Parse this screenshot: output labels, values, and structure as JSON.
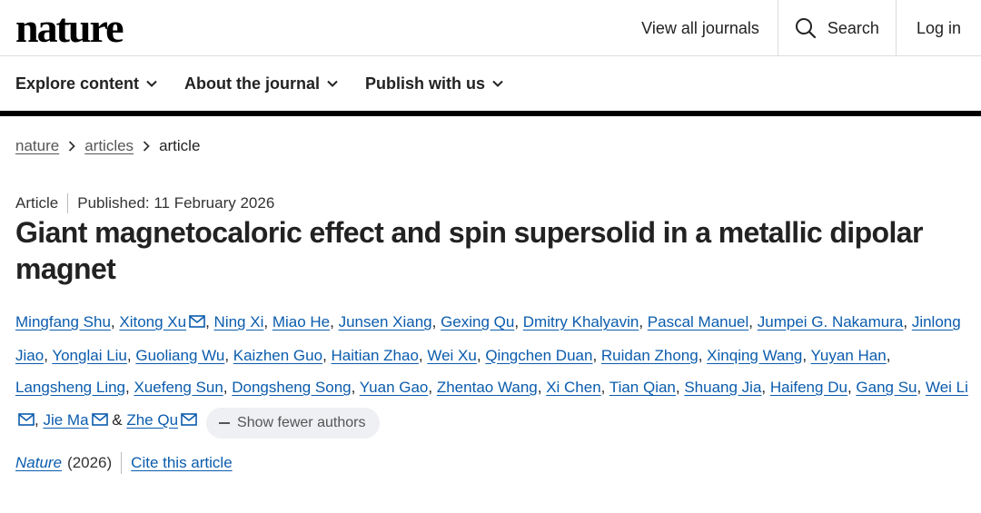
{
  "header": {
    "logo": "nature",
    "links": {
      "journals": "View all journals",
      "search": "Search",
      "login": "Log in"
    }
  },
  "nav": {
    "items": [
      "Explore content",
      "About the journal",
      "Publish with us"
    ]
  },
  "breadcrumb": {
    "items": [
      "nature",
      "articles",
      "article"
    ]
  },
  "article": {
    "type": "Article",
    "published": "Published: 11 February 2026",
    "title": "Giant magnetocaloric effect and spin supersolid in a metallic dipolar magnet",
    "show_fewer_label": "Show fewer authors",
    "journal": "Nature",
    "year": "(2026)",
    "cite_label": "Cite this article"
  },
  "authors": [
    {
      "name": "Mingfang Shu",
      "mail": false
    },
    {
      "name": "Xitong Xu",
      "mail": true
    },
    {
      "name": "Ning Xi",
      "mail": false
    },
    {
      "name": "Miao He",
      "mail": false
    },
    {
      "name": "Junsen Xiang",
      "mail": false
    },
    {
      "name": "Gexing Qu",
      "mail": false
    },
    {
      "name": "Dmitry Khalyavin",
      "mail": false
    },
    {
      "name": "Pascal Manuel",
      "mail": false
    },
    {
      "name": "Jumpei G. Nakamura",
      "mail": false
    },
    {
      "name": "Jinlong Jiao",
      "mail": false
    },
    {
      "name": "Yonglai Liu",
      "mail": false
    },
    {
      "name": "Guoliang Wu",
      "mail": false
    },
    {
      "name": "Kaizhen Guo",
      "mail": false
    },
    {
      "name": "Haitian Zhao",
      "mail": false
    },
    {
      "name": "Wei Xu",
      "mail": false
    },
    {
      "name": "Qingchen Duan",
      "mail": false
    },
    {
      "name": "Ruidan Zhong",
      "mail": false
    },
    {
      "name": "Xinqing Wang",
      "mail": false
    },
    {
      "name": "Yuyan Han",
      "mail": false
    },
    {
      "name": "Langsheng Ling",
      "mail": false
    },
    {
      "name": "Xuefeng Sun",
      "mail": false
    },
    {
      "name": "Dongsheng Song",
      "mail": false
    },
    {
      "name": "Yuan Gao",
      "mail": false
    },
    {
      "name": "Zhentao Wang",
      "mail": false
    },
    {
      "name": "Xi Chen",
      "mail": false
    },
    {
      "name": "Tian Qian",
      "mail": false
    },
    {
      "name": "Shuang Jia",
      "mail": false
    },
    {
      "name": "Haifeng Du",
      "mail": false
    },
    {
      "name": "Gang Su",
      "mail": false
    },
    {
      "name": "Wei Li",
      "mail": true
    },
    {
      "name": "Jie Ma",
      "mail": true
    },
    {
      "name": "Zhe Qu",
      "mail": true
    }
  ],
  "colors": {
    "link": "#0b5cad",
    "rule": "#000000",
    "button_bg": "#eef0f3"
  }
}
